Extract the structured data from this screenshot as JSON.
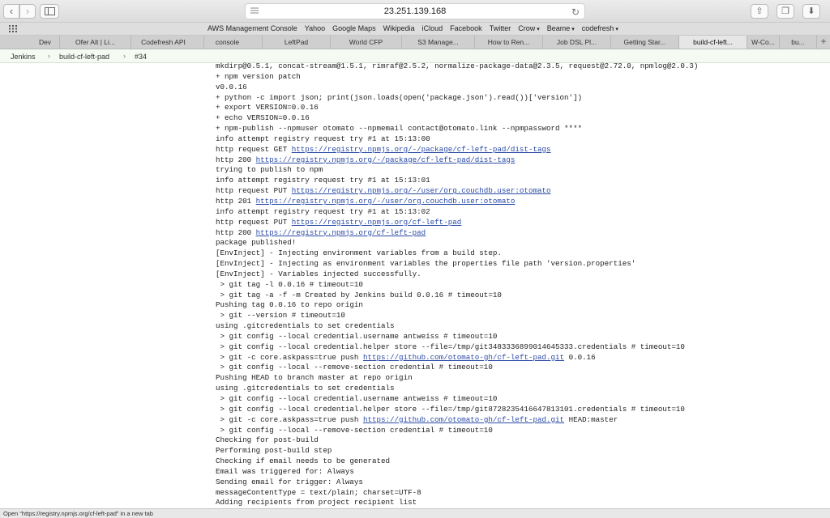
{
  "browser": {
    "url": "23.251.139.168",
    "bookmarks": [
      {
        "label": "AWS Management Console",
        "menu": false
      },
      {
        "label": "Yahoo",
        "menu": false
      },
      {
        "label": "Google Maps",
        "menu": false
      },
      {
        "label": "Wikipedia",
        "menu": false
      },
      {
        "label": "iCloud",
        "menu": false
      },
      {
        "label": "Facebook",
        "menu": false
      },
      {
        "label": "Twitter",
        "menu": false
      },
      {
        "label": "Crow",
        "menu": true
      },
      {
        "label": "Beame",
        "menu": true
      },
      {
        "label": "codefresh",
        "menu": true
      }
    ],
    "tabs": [
      {
        "label": "Dev",
        "active": false
      },
      {
        "label": "Ofer Alt | Li...",
        "active": false
      },
      {
        "label": "Codefresh API",
        "active": false
      },
      {
        "label": "console",
        "active": false
      },
      {
        "label": "LeftPad",
        "active": false
      },
      {
        "label": "World CFP",
        "active": false
      },
      {
        "label": "S3 Manage...",
        "active": false
      },
      {
        "label": "How to Ren...",
        "active": false
      },
      {
        "label": "Job DSL Pl...",
        "active": false
      },
      {
        "label": "Getting Star...",
        "active": false
      },
      {
        "label": "build-cf-left...",
        "active": true
      },
      {
        "label": "W-Co...",
        "active": false
      },
      {
        "label": "bu...",
        "active": false
      }
    ],
    "status": "Open “https://registry.npmjs.org/cf-left-pad” in a new tab"
  },
  "breadcrumb": {
    "items": [
      "Jenkins",
      "build-cf-left-pad",
      "#34"
    ]
  },
  "console": {
    "lines": [
      {
        "text": "mkdirp@0.5.1, concat-stream@1.5.1, rimraf@2.5.2, normalize-package-data@2.3.5, request@2.72.0, npmlog@2.0.3)"
      },
      {
        "text": "+ npm version patch"
      },
      {
        "text": "v0.0.16"
      },
      {
        "text": "+ python -c import json; print(json.loads(open('package.json').read())['version'])"
      },
      {
        "text": "+ export VERSION=0.0.16"
      },
      {
        "text": "+ echo VERSION=0.0.16"
      },
      {
        "text": "+ npm-publish --npmuser otomato --npmemail contact@otomato.link --npmpassword ****"
      },
      {
        "text": "info attempt registry request try #1 at 15:13:00"
      },
      {
        "text": "http request GET ",
        "link": "https://registry.npmjs.org/-/package/cf-left-pad/dist-tags"
      },
      {
        "text": "http 200 ",
        "link": "https://registry.npmjs.org/-/package/cf-left-pad/dist-tags"
      },
      {
        "text": "trying to publish to npm"
      },
      {
        "text": "info attempt registry request try #1 at 15:13:01"
      },
      {
        "text": "http request PUT ",
        "link": "https://registry.npmjs.org/-/user/org.couchdb.user:otomato"
      },
      {
        "text": "http 201 ",
        "link": "https://registry.npmjs.org/-/user/org.couchdb.user:otomato"
      },
      {
        "text": "info attempt registry request try #1 at 15:13:02"
      },
      {
        "text": "http request PUT ",
        "link": "https://registry.npmjs.org/cf-left-pad"
      },
      {
        "text": "http 200 ",
        "link": "https://registry.npmjs.org/cf-left-pad"
      },
      {
        "text": "package published!"
      },
      {
        "text": "[EnvInject] - Injecting environment variables from a build step."
      },
      {
        "text": "[EnvInject] - Injecting as environment variables the properties file path 'version.properties'"
      },
      {
        "text": "[EnvInject] - Variables injected successfully."
      },
      {
        "text": " > git tag -l 0.0.16 # timeout=10"
      },
      {
        "text": " > git tag -a -f -m Created by Jenkins build 0.0.16 # timeout=10"
      },
      {
        "text": "Pushing tag 0.0.16 to repo origin"
      },
      {
        "text": " > git --version # timeout=10"
      },
      {
        "text": "using .gitcredentials to set credentials"
      },
      {
        "text": " > git config --local credential.username antweiss # timeout=10"
      },
      {
        "text": " > git config --local credential.helper store --file=/tmp/git3483336899014645333.credentials # timeout=10"
      },
      {
        "text": " > git -c core.askpass=true push ",
        "link": "https://github.com/otomato-gh/cf-left-pad.git",
        "after": " 0.0.16"
      },
      {
        "text": " > git config --local --remove-section credential # timeout=10"
      },
      {
        "text": "Pushing HEAD to branch master at repo origin"
      },
      {
        "text": "using .gitcredentials to set credentials"
      },
      {
        "text": " > git config --local credential.username antweiss # timeout=10"
      },
      {
        "text": " > git config --local credential.helper store --file=/tmp/git8728235416647813101.credentials # timeout=10"
      },
      {
        "text": " > git -c core.askpass=true push ",
        "link": "https://github.com/otomato-gh/cf-left-pad.git",
        "after": " HEAD:master"
      },
      {
        "text": " > git config --local --remove-section credential # timeout=10"
      },
      {
        "text": "Checking for post-build"
      },
      {
        "text": "Performing post-build step"
      },
      {
        "text": "Checking if email needs to be generated"
      },
      {
        "text": "Email was triggered for: Always"
      },
      {
        "text": "Sending email for trigger: Always"
      },
      {
        "text": "messageContentType = text/plain; charset=UTF-8"
      },
      {
        "text": "Adding recipients from project recipient list"
      }
    ]
  }
}
